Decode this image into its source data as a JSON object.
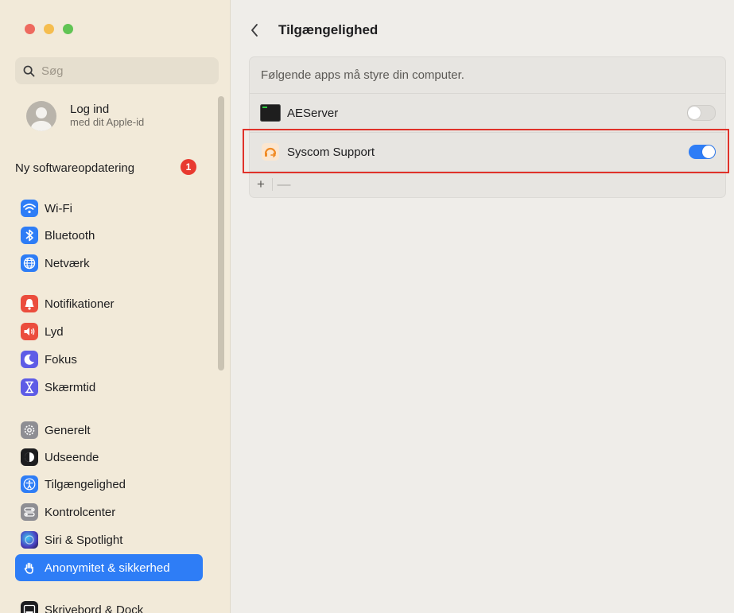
{
  "sidebar": {
    "search_placeholder": "Søg",
    "account": {
      "title": "Log ind",
      "subtitle": "med dit Apple-id"
    },
    "update": {
      "label": "Ny softwareopdatering",
      "badge": "1"
    },
    "items": [
      {
        "label": "Wi-Fi",
        "icon": "wifi-icon",
        "color": "#2e7df6"
      },
      {
        "label": "Bluetooth",
        "icon": "bluetooth-icon",
        "color": "#2e7df6"
      },
      {
        "label": "Netværk",
        "icon": "globe-icon",
        "color": "#2e7df6"
      },
      {
        "label": "Notifikationer",
        "icon": "bell-icon",
        "color": "#eb4d3d"
      },
      {
        "label": "Lyd",
        "icon": "speaker-icon",
        "color": "#eb4d3d"
      },
      {
        "label": "Fokus",
        "icon": "moon-icon",
        "color": "#5e5ce6"
      },
      {
        "label": "Skærmtid",
        "icon": "hourglass-icon",
        "color": "#5e5ce6"
      },
      {
        "label": "Generelt",
        "icon": "gear-icon",
        "color": "#8e8e93"
      },
      {
        "label": "Udseende",
        "icon": "appearance-icon",
        "color": "#1d1d1f"
      },
      {
        "label": "Tilgængelighed",
        "icon": "accessibility-icon",
        "color": "#2e7df6"
      },
      {
        "label": "Kontrolcenter",
        "icon": "control-center-icon",
        "color": "#8e8e93"
      },
      {
        "label": "Siri & Spotlight",
        "icon": "siri-icon",
        "color": "#4b3fbf"
      },
      {
        "label": "Anonymitet & sikkerhed",
        "icon": "hand-icon",
        "color": "#2e7df6",
        "selected": true
      },
      {
        "label": "Skrivebord & Dock",
        "icon": "dock-icon",
        "color": "#1d1d1f"
      }
    ]
  },
  "main": {
    "title": "Tilgængelighed",
    "panel_header": "Følgende apps må styre din computer.",
    "apps": [
      {
        "name": "AEServer",
        "icon": "terminal-icon",
        "enabled": false
      },
      {
        "name": "Syscom Support",
        "icon": "syscom-support-icon",
        "enabled": true
      }
    ],
    "add_label": "+",
    "remove_label": "—"
  },
  "colors": {
    "accent": "#2e7df6",
    "highlight": "#e0322a",
    "sidebar_bg": "#f2ead9"
  }
}
